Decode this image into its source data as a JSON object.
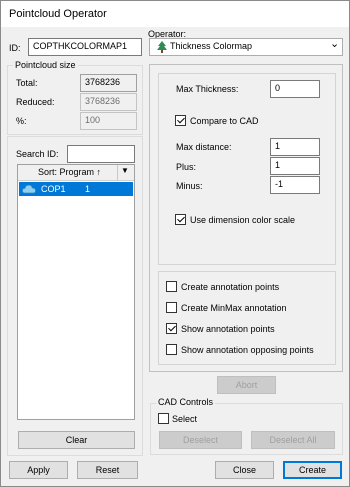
{
  "window": {
    "title": "Pointcloud Operator"
  },
  "id_field": {
    "label": "ID:",
    "value": "COPTHKCOLORMAP1"
  },
  "pointcloud_size": {
    "title": "Pointcloud size",
    "total_label": "Total:",
    "total_value": "3768236",
    "reduced_label": "Reduced:",
    "reduced_value": "3768236",
    "percent_label": "%:",
    "percent_value": "100"
  },
  "search": {
    "label": "Search ID:",
    "value": ""
  },
  "sort": {
    "label": "Sort: Program ↑",
    "dropdown_glyph": "▼"
  },
  "list": {
    "items": [
      {
        "name": "COP1",
        "value": "1",
        "icon": "cloud-icon"
      }
    ]
  },
  "clear_label": "Clear",
  "operator": {
    "label": "Operator:",
    "selected": "Thickness Colormap",
    "icon": "tree-icon",
    "chevron": "⌄"
  },
  "params": {
    "max_thickness_label": "Max Thickness:",
    "max_thickness_value": "0",
    "compare_cad_label": "Compare to CAD",
    "compare_cad_checked": true,
    "max_distance_label": "Max distance:",
    "max_distance_value": "1",
    "plus_label": "Plus:",
    "plus_value": "1",
    "minus_label": "Minus:",
    "minus_value": "-1",
    "dim_color_scale_label": "Use dimension color scale",
    "dim_color_scale_checked": true
  },
  "annotations": {
    "create_points_label": "Create annotation points",
    "create_points_checked": false,
    "minmax_label": "Create MinMax annotation",
    "minmax_checked": false,
    "show_points_label": "Show annotation points",
    "show_points_checked": true,
    "show_opposing_label": "Show annotation opposing points",
    "show_opposing_checked": false
  },
  "abort_label": "Abort",
  "cad_controls": {
    "title": "CAD Controls",
    "select_label": "Select",
    "select_checked": false,
    "deselect_label": "Deselect",
    "deselect_all_label": "Deselect All"
  },
  "footer": {
    "apply_label": "Apply",
    "reset_label": "Reset",
    "close_label": "Close",
    "create_label": "Create"
  },
  "colors": {
    "selection": "#0078d7",
    "cloud_icon": "#8fd0f0",
    "tree_icon": "#2e8b57"
  }
}
